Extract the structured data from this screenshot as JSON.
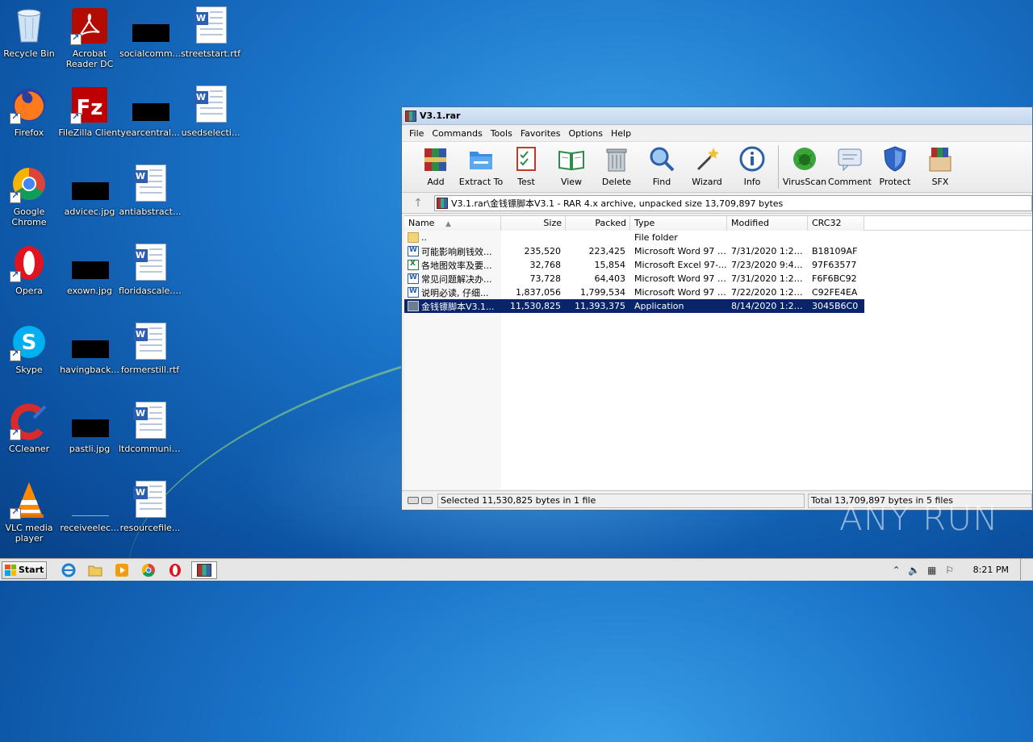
{
  "desktop": {
    "icons": [
      {
        "label": "Recycle Bin"
      },
      {
        "label": "Acrobat Reader DC"
      },
      {
        "label": "socialcomm..."
      },
      {
        "label": "streetstart.rtf"
      },
      {
        "label": "Firefox"
      },
      {
        "label": "FileZilla Client"
      },
      {
        "label": "yearcentral..."
      },
      {
        "label": "usedselecti..."
      },
      {
        "label": "Google Chrome"
      },
      {
        "label": "advicec.jpg"
      },
      {
        "label": "antiabstract..."
      },
      {
        "label": "Opera"
      },
      {
        "label": "exown.jpg"
      },
      {
        "label": "floridascale.rtf"
      },
      {
        "label": "Skype"
      },
      {
        "label": "havingback..."
      },
      {
        "label": "formerstill.rtf"
      },
      {
        "label": "CCleaner"
      },
      {
        "label": "pastli.jpg"
      },
      {
        "label": "ltdcommunit..."
      },
      {
        "label": "VLC media player"
      },
      {
        "label": "receiveelec..."
      },
      {
        "label": "resourcefile..."
      }
    ]
  },
  "window": {
    "title": "V3.1.rar",
    "menu": [
      "File",
      "Commands",
      "Tools",
      "Favorites",
      "Options",
      "Help"
    ],
    "toolbar": [
      "Add",
      "Extract To",
      "Test",
      "View",
      "Delete",
      "Find",
      "Wizard",
      "Info",
      "VirusScan",
      "Comment",
      "Protect",
      "SFX"
    ],
    "address": "V3.1.rar\\金钱镖脚本V3.1 - RAR 4.x archive, unpacked size 13,709,897 bytes",
    "columns": {
      "name": "Name",
      "size": "Size",
      "packed": "Packed",
      "type": "Type",
      "modified": "Modified",
      "crc": "CRC32"
    },
    "files": [
      {
        "name": "..",
        "size": "",
        "packed": "",
        "type": "File folder",
        "modified": "",
        "crc": ""
      },
      {
        "name": "可能影响刷钱效...",
        "size": "235,520",
        "packed": "223,425",
        "type": "Microsoft Word 97 -...",
        "modified": "7/31/2020 1:27...",
        "crc": "B18109AF"
      },
      {
        "name": "各地图效率及要...",
        "size": "32,768",
        "packed": "15,854",
        "type": "Microsoft Excel 97-...",
        "modified": "7/23/2020 9:49...",
        "crc": "97F63577"
      },
      {
        "name": "常见问题解决办...",
        "size": "73,728",
        "packed": "64,403",
        "type": "Microsoft Word 97 -...",
        "modified": "7/31/2020 1:26...",
        "crc": "F6F6BC92"
      },
      {
        "name": "说明必读, 仔细...",
        "size": "1,837,056",
        "packed": "1,799,534",
        "type": "Microsoft Word 97 -...",
        "modified": "7/22/2020 1:28...",
        "crc": "C92FE4EA"
      },
      {
        "name": "金钱镖脚本V3.1...",
        "size": "11,530,825",
        "packed": "11,393,375",
        "type": "Application",
        "modified": "8/14/2020 1:26...",
        "crc": "3045B6C0"
      }
    ],
    "status_left": "Selected 11,530,825 bytes in 1 file",
    "status_right": "Total 13,709,897 bytes in 5 files"
  },
  "watermark": "ANY RUN",
  "taskbar": {
    "start_label": "Start",
    "clock": "8:21 PM"
  }
}
